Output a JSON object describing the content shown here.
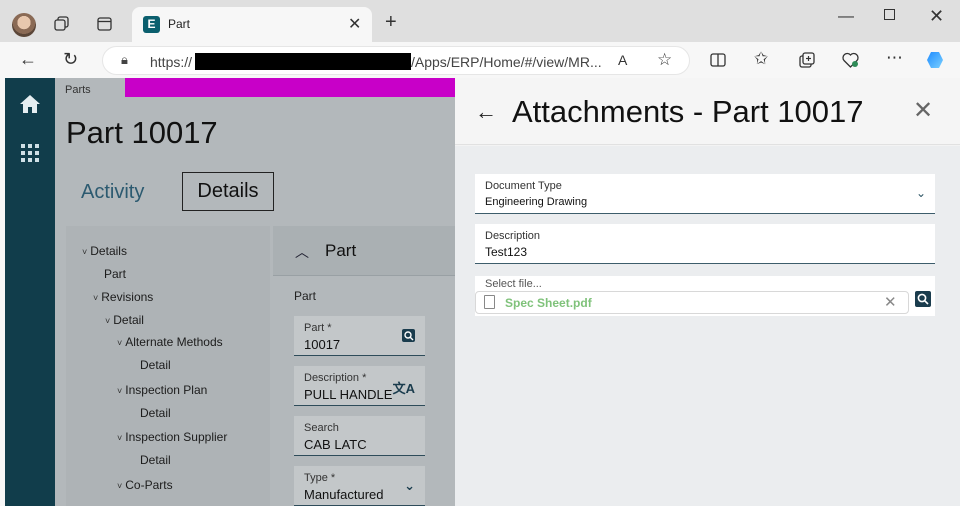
{
  "browser": {
    "tab_title": "Part",
    "tab_favicon": "E",
    "url_prefix": "https://",
    "url_suffix": "/Apps/ERP/Home/#/view/MR..."
  },
  "app": {
    "breadcrumb": "Parts",
    "page_title": "Part 10017",
    "tabs": [
      {
        "label": "Activity"
      },
      {
        "label": "Details"
      }
    ],
    "tree": [
      {
        "label": "Details",
        "chevron": true
      },
      {
        "label": "Part",
        "chevron": false
      },
      {
        "label": "Revisions",
        "chevron": true
      },
      {
        "label": "Detail",
        "chevron": true
      },
      {
        "label": "Alternate Methods",
        "chevron": true
      },
      {
        "label": "Detail",
        "chevron": false
      },
      {
        "label": "Inspection Plan",
        "chevron": true
      },
      {
        "label": "Detail",
        "chevron": false
      },
      {
        "label": "Inspection Supplier",
        "chevron": true
      },
      {
        "label": "Detail",
        "chevron": false
      },
      {
        "label": "Co-Parts",
        "chevron": true
      }
    ],
    "part_panel": {
      "header": "Part",
      "subheader": "Part",
      "fields": [
        {
          "label": "Part *",
          "value": "10017",
          "icon": "search-icon"
        },
        {
          "label": "Description *",
          "value": "PULL HANDLE",
          "icon": "translate-icon"
        },
        {
          "label": "Search",
          "value": "CAB LATC",
          "icon": ""
        },
        {
          "label": "Type *",
          "value": "Manufactured",
          "icon": "chevron-down-icon"
        }
      ]
    }
  },
  "attachments": {
    "title": "Attachments - Part 10017",
    "document_type_label": "Document Type",
    "document_type_value": "Engineering Drawing",
    "description_label": "Description",
    "description_value": "Test123",
    "file_label": "Select file...",
    "file_name": "Spec Sheet.pdf"
  },
  "colors": {
    "nav": "#113d4b",
    "accent_bar": "#c800c8",
    "file_link": "#7fc27a"
  }
}
